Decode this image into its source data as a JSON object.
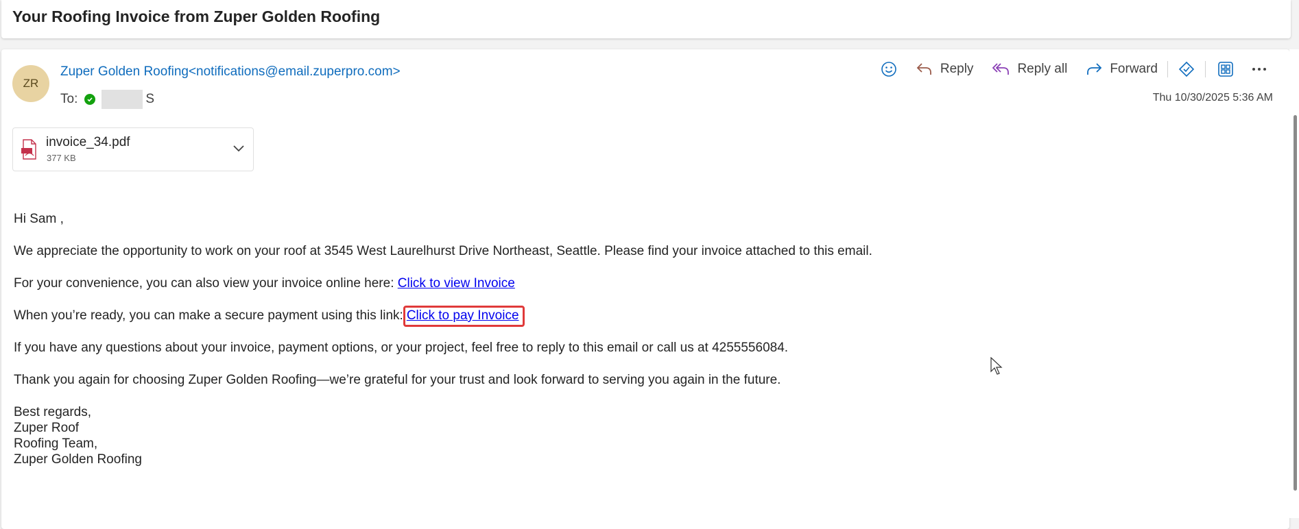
{
  "subject": "Your Roofing Invoice from Zuper Golden Roofing",
  "sender": {
    "avatar_initials": "ZR",
    "name": "Zuper Golden Roofing",
    "email": "<notifications@email.zuperpro.com>"
  },
  "to": {
    "label": "To:",
    "recipient_suffix": "S"
  },
  "toolbar": {
    "reply": "Reply",
    "reply_all": "Reply all",
    "forward": "Forward"
  },
  "date": "Thu 10/30/2025 5:36 AM",
  "attachment": {
    "name": "invoice_34.pdf",
    "size": "377 KB"
  },
  "body": {
    "greeting": "Hi Sam ,",
    "p1": "We appreciate the opportunity to work on your roof at 3545 West Laurelhurst Drive Northeast, Seattle. Please find your invoice attached to this email.",
    "p2_text": "For your convenience, you can also view your invoice online here: ",
    "p2_link": "Click to view Invoice",
    "p3_text": "When you’re ready, you can make a secure payment using this link:",
    "p3_link": "Click to pay Invoice",
    "p4": "If you have any questions about your invoice, payment options, or your project, feel free to reply to this email or call us at 4255556084.",
    "p5": "Thank you again for choosing Zuper Golden Roofing—we’re grateful for your trust and look forward to serving you again in the future.",
    "signature": [
      "Best regards,",
      "Zuper Roof",
      "Roofing Team,",
      "Zuper Golden Roofing"
    ]
  },
  "colors": {
    "accent": "#0f6cbd",
    "link": "#0000ee",
    "highlight": "#e03a3a",
    "reply_all_icon": "#8a3fb5",
    "verified": "#13a10e"
  },
  "icons": [
    "emoji-icon",
    "reply-icon",
    "reply-all-icon",
    "forward-icon",
    "tag-icon",
    "apps-icon",
    "more-icon",
    "check-icon",
    "pdf-icon",
    "chevron-down-icon",
    "mouse-cursor-icon"
  ]
}
